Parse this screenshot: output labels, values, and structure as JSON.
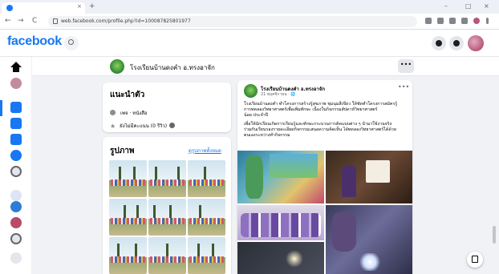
{
  "browser": {
    "tab_close": "×",
    "new_tab": "+",
    "url": "web.facebook.com/profile.php?id=100087825801977",
    "nav_back": "←",
    "nav_forward": "→",
    "nav_reload": "C",
    "win_minimize": "–",
    "win_maximize": "□",
    "win_close": "×"
  },
  "header": {
    "logo": "facebook"
  },
  "pagebar": {
    "page_name": "โรงเรียนบ้านดงคำ อ.ทรงอาจัก",
    "more": "•••"
  },
  "intro": {
    "title": "แนะนำตัว",
    "category": "เพจ · หนังสือ",
    "rating": "ยังไม่มีคะแนน (0 รีวิว)"
  },
  "photos": {
    "title": "รูปภาพ",
    "see_all": "ดูรูปภาพทั้งหมด"
  },
  "post": {
    "author": "โรงเรียนบ้านดงคำ อ.ทรงอาจัก",
    "meta": "21 พฤศจิกายน · 🌐",
    "more": "•••",
    "text_lines": [
      "โรงเรียนบ้านดงคำ ทำโครงการสร้างรู้สุขภาพ ชุมนุมสีเขียว ให้ชัดทำโครงการสมัครรู้",
      "การทดลองวิทยาศาสตร์เพื่อเพิ่มทักษะ เนื่องในกิจกรรมสัปดาห์วิทยาศาสตร์",
      "น้อย ประจำปี",
      "    เพื่อให้นักเรียนเกิดการเรียนรู้และทักษะกระบวนการคิดแบบต่าง ๆ นำมาใช้งานจริง",
      "ร่วมกันเรียนรองรายละเอียดกิจกรรมเสนอความคิดเห็น ได้ทดลองวิทยาศาสตร์ได้ด้วย",
      "ตนเองระหว่างทำกิจกรรม"
    ]
  },
  "colors": {
    "brand": "#1877f2",
    "background": "#f0f2f5"
  }
}
